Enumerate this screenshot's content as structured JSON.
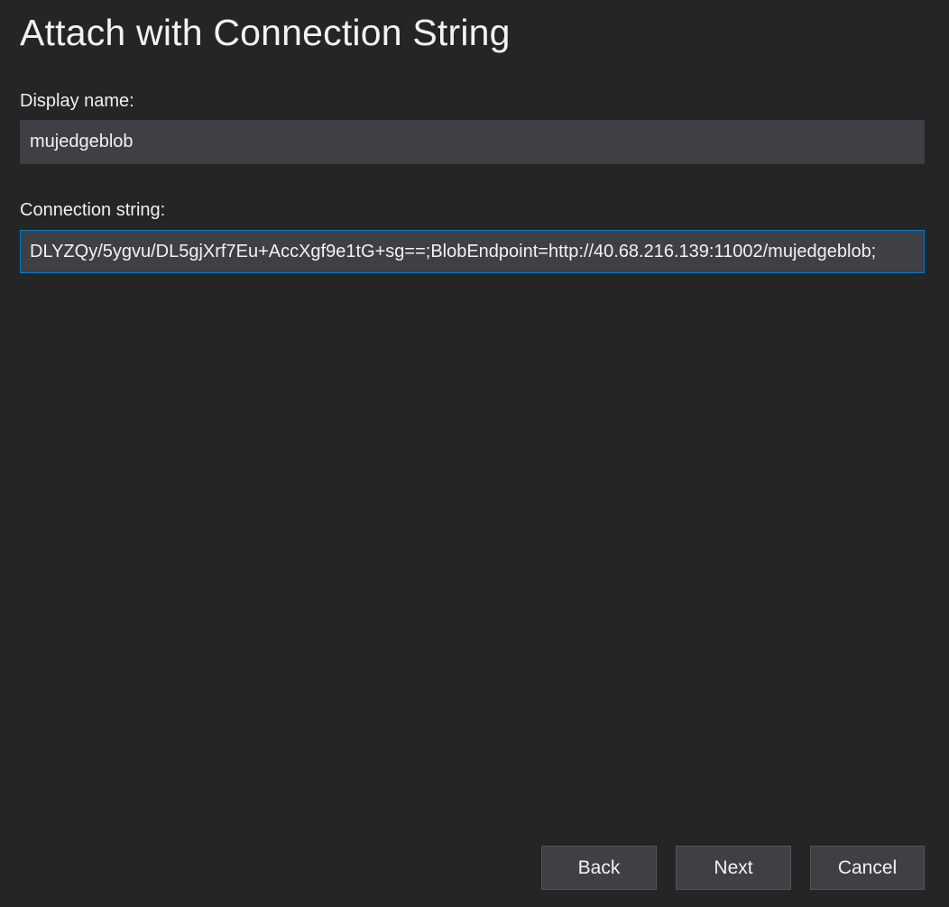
{
  "dialog": {
    "title": "Attach with Connection String",
    "display_name": {
      "label": "Display name:",
      "value": "mujedgeblob"
    },
    "connection_string": {
      "label": "Connection string:",
      "value": "DLYZQy/5ygvu/DL5gjXrf7Eu+AccXgf9e1tG+sg==;BlobEndpoint=http://40.68.216.139:11002/mujedgeblob;"
    },
    "buttons": {
      "back": "Back",
      "next": "Next",
      "cancel": "Cancel"
    }
  },
  "colors": {
    "background": "#252526",
    "input_background": "#3f3f46",
    "focus_border": "#007acc"
  }
}
